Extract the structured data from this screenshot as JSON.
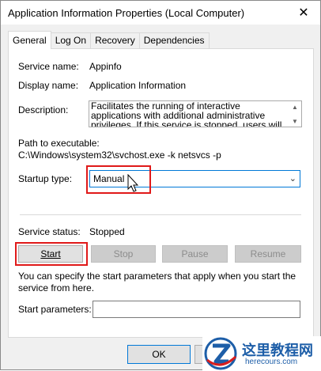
{
  "window": {
    "title": "Application Information Properties (Local Computer)",
    "close_glyph": "✕"
  },
  "tabs": [
    {
      "label": "General",
      "active": true
    },
    {
      "label": "Log On"
    },
    {
      "label": "Recovery"
    },
    {
      "label": "Dependencies"
    }
  ],
  "general": {
    "service_name_label": "Service name:",
    "service_name_value": "Appinfo",
    "display_name_label": "Display name:",
    "display_name_value": "Application Information",
    "description_label": "Description:",
    "description_value": "Facilitates the running of interactive applications with additional administrative privileges.  If this service is stopped, users will be unable to launch applications",
    "path_label": "Path to executable:",
    "path_value": "C:\\Windows\\system32\\svchost.exe -k netsvcs -p",
    "startup_type_label": "Startup type:",
    "startup_type_value": "Manual",
    "service_status_label": "Service status:",
    "service_status_value": "Stopped",
    "buttons": {
      "start": "Start",
      "stop": "Stop",
      "pause": "Pause",
      "resume": "Resume"
    },
    "hint_text": "You can specify the start parameters that apply when you start the service from here.",
    "start_params_label": "Start parameters:",
    "start_params_value": ""
  },
  "footer": {
    "ok": "OK"
  },
  "watermark": {
    "title": "这里教程网",
    "url": "herecours.com"
  },
  "colors": {
    "highlight_red": "#e01919",
    "focus_blue": "#0078d7"
  }
}
